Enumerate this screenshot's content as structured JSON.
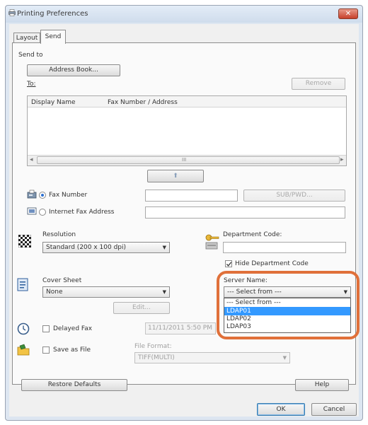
{
  "window": {
    "title": "Printing Preferences",
    "close_glyph": "✕"
  },
  "tabs": [
    {
      "label": "Layout"
    },
    {
      "label": "Send"
    }
  ],
  "send_to": {
    "group_label": "Send to",
    "address_book_button": "Address Book...",
    "to_label": "To:",
    "remove_button": "Remove",
    "columns": [
      "Display Name",
      "Fax Number / Address"
    ],
    "scroll_left": "◂",
    "scroll_right": "▸",
    "scroll_grip": "III",
    "add_arrow": "⬆"
  },
  "destination": {
    "fax_number_label": "Fax Number",
    "sub_pwd_button": "SUB/PWD...",
    "internet_fax_label": "Internet Fax Address"
  },
  "resolution": {
    "label": "Resolution",
    "value": "Standard (200 x 100 dpi)"
  },
  "department": {
    "label": "Department Code:",
    "hide_label": "Hide Department Code"
  },
  "cover_sheet": {
    "label": "Cover Sheet",
    "value": "None",
    "edit_button": "Edit..."
  },
  "server": {
    "label": "Server Name:",
    "value": "--- Select from ---",
    "options": [
      {
        "label": "--- Select from ---"
      },
      {
        "label": "LDAP01",
        "selected": true
      },
      {
        "label": "LDAP02"
      },
      {
        "label": "LDAP03"
      }
    ]
  },
  "delayed_fax": {
    "label": "Delayed Fax",
    "value": "11/11/2011 5:50 PM"
  },
  "save_as_file": {
    "label": "Save as File",
    "format_label": "File Format:",
    "format_value": "TIFF(MULTI)"
  },
  "buttons": {
    "restore": "Restore Defaults",
    "help": "Help",
    "ok": "OK",
    "cancel": "Cancel"
  },
  "colors": {
    "highlight": "#3399ff",
    "callout": "#e0703a",
    "accent": "#2c6fd1"
  }
}
